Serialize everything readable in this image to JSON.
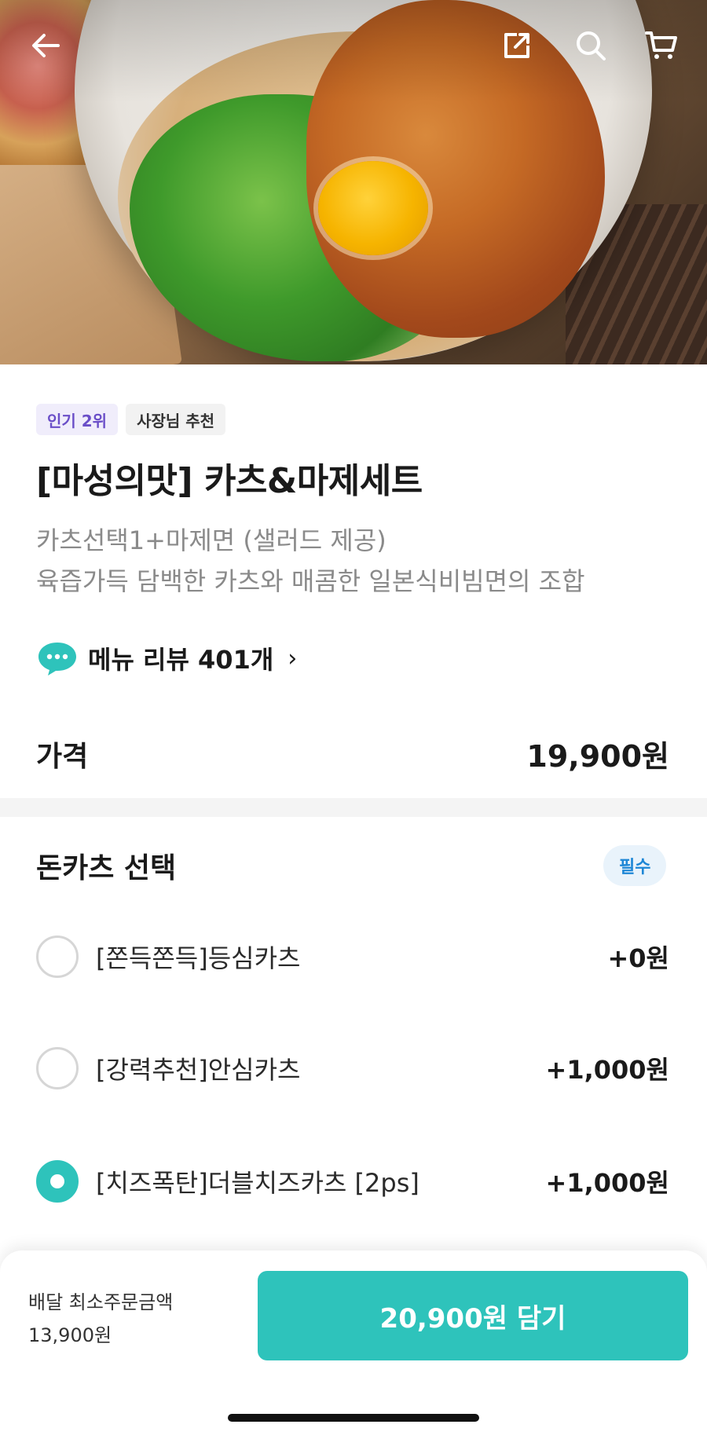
{
  "header": {
    "back_icon": "arrow-left-icon",
    "share_icon": "share-icon",
    "search_icon": "search-icon",
    "cart_icon": "cart-icon"
  },
  "product": {
    "badges": [
      "인기 2위",
      "사장님 추천"
    ],
    "title": "[마성의맛] 카츠&마제세트",
    "description_line1": "카츠선택1+마제면 (샐러드 제공)",
    "description_line2": "육즙가득 담백한 카츠와 매콤한 일본식비빔면의 조합",
    "review_text": "메뉴 리뷰 401개",
    "review_chevron": "›",
    "price_label": "가격",
    "price_value": "19,900원"
  },
  "option_section": {
    "title": "돈카츠 선택",
    "required_label": "필수",
    "options": [
      {
        "name": "[쫀득쫀득]등심카츠",
        "price": "+0원",
        "selected": false
      },
      {
        "name": "[강력추천]안심카츠",
        "price": "+1,000원",
        "selected": false
      },
      {
        "name": "[치즈폭탄]더블치즈카츠 [2ps]",
        "price": "+1,000원",
        "selected": true
      }
    ]
  },
  "bottom_bar": {
    "min_order_label": "배달 최소주문금액",
    "min_order_value": "13,900원",
    "cta_label": "20,900원 담기"
  },
  "colors": {
    "accent": "#2ec3bb",
    "badge_purple_text": "#6a4ec8",
    "required_text": "#1e87d6"
  }
}
